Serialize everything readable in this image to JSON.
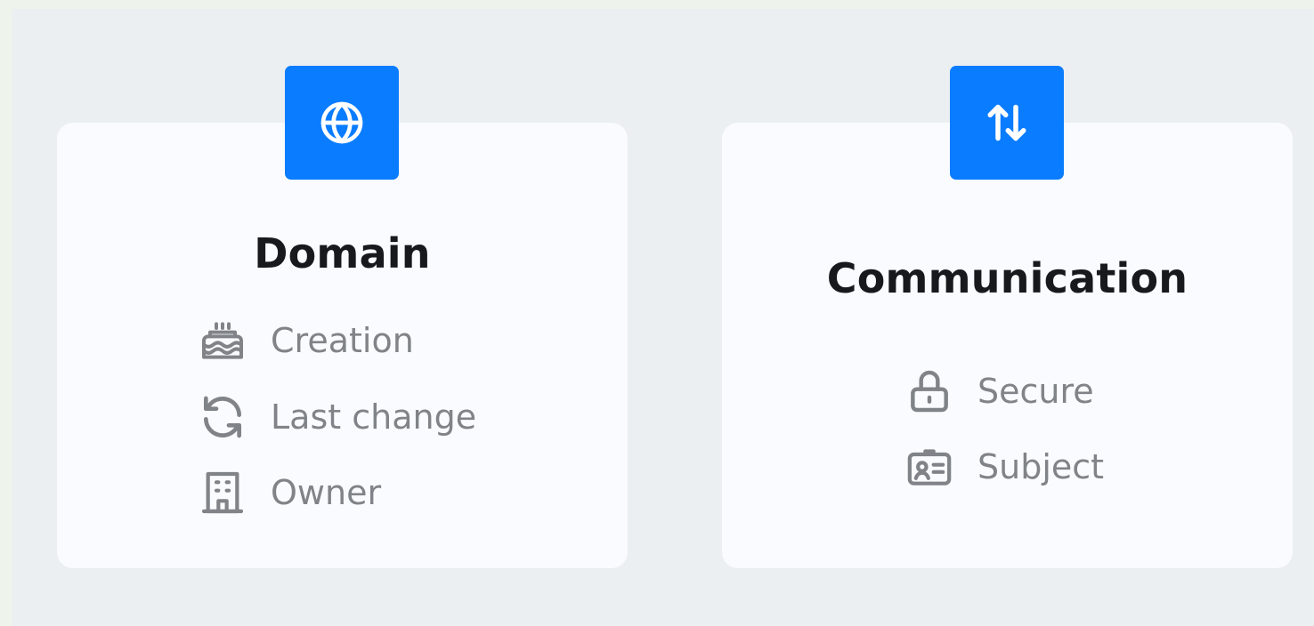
{
  "colors": {
    "accent": "#0a7cff",
    "title": "#17191c",
    "muted": "#808387",
    "card": "#f9fbfe",
    "panel": "#ebeff1"
  },
  "domain_card": {
    "icon": "globe-icon",
    "title": "Domain",
    "items": [
      {
        "icon": "cake-icon",
        "label": "Creation"
      },
      {
        "icon": "refresh-icon",
        "label": "Last change"
      },
      {
        "icon": "building-icon",
        "label": "Owner"
      }
    ]
  },
  "communication_card": {
    "icon": "arrows-up-down-icon",
    "title": "Communication",
    "items": [
      {
        "icon": "lock-icon",
        "label": "Secure"
      },
      {
        "icon": "id-card-icon",
        "label": "Subject"
      }
    ]
  }
}
